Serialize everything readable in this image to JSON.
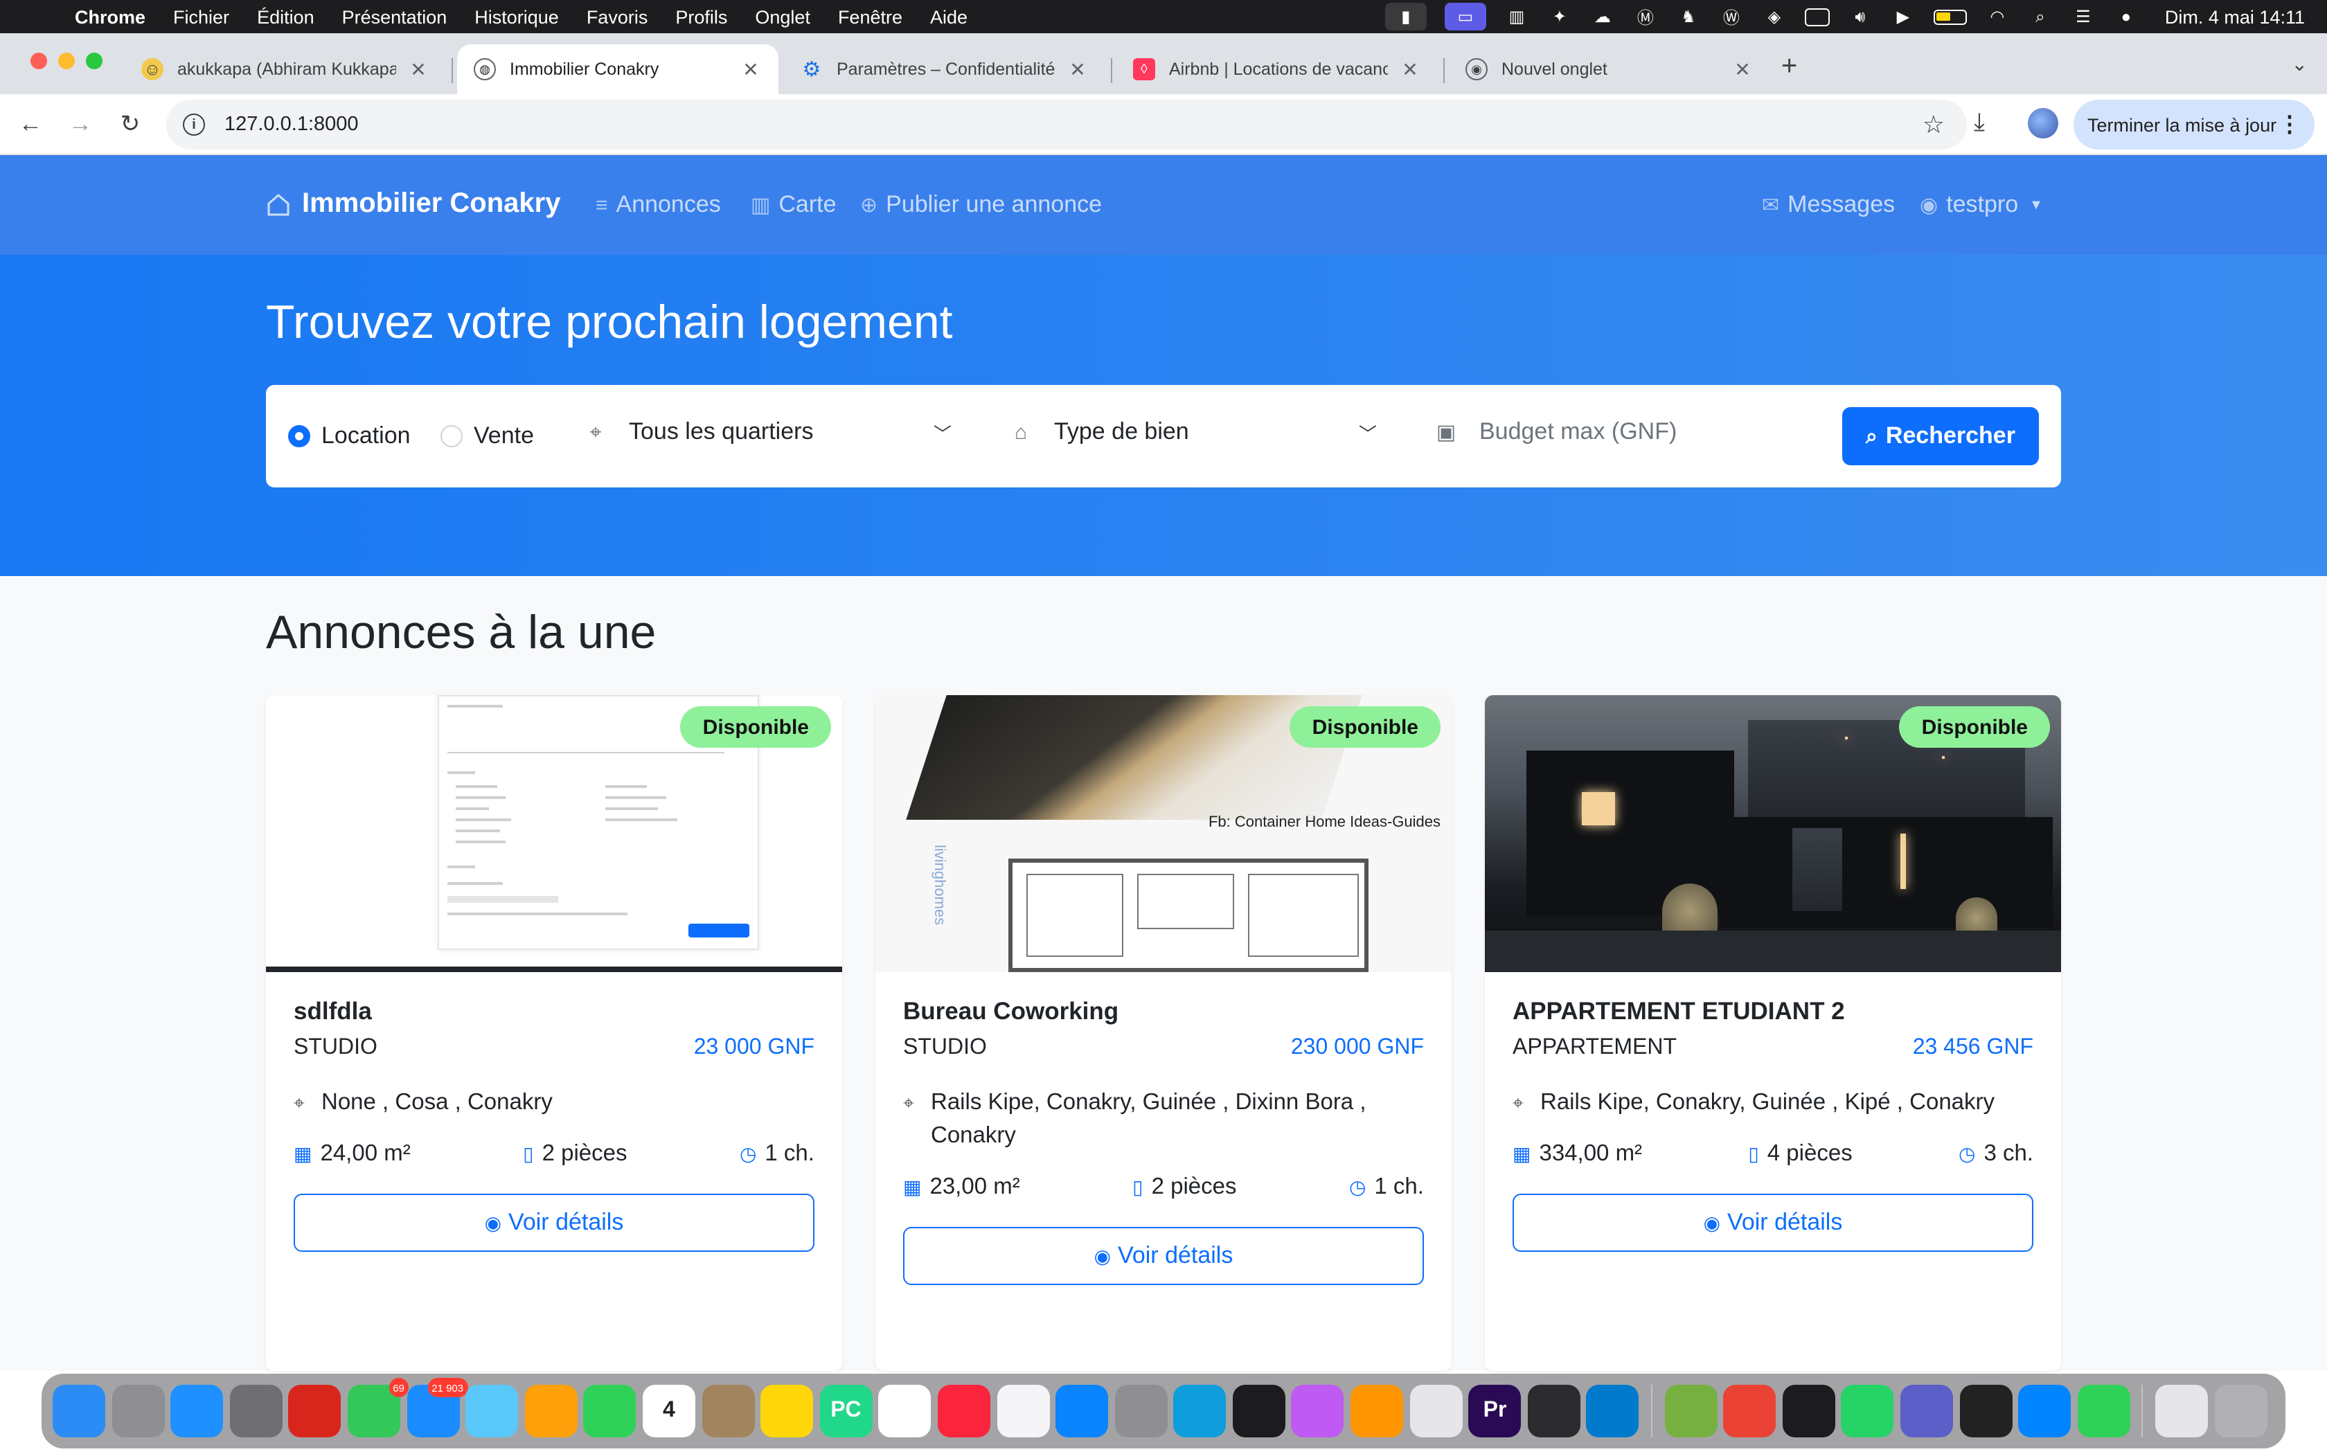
{
  "menubar": {
    "app": "Chrome",
    "items": [
      "Fichier",
      "Édition",
      "Présentation",
      "Historique",
      "Favoris",
      "Profils",
      "Onglet",
      "Fenêtre",
      "Aide"
    ],
    "clock": "Dim. 4 mai  14:11"
  },
  "tabs": [
    {
      "title": "akukkapa (Abhiram Kukkapalli)",
      "active": false
    },
    {
      "title": "Immobilier Conakry",
      "active": true
    },
    {
      "title": "Paramètres – Confidentialité et sécurité",
      "active": false
    },
    {
      "title": "Airbnb | Locations de vacances",
      "active": false
    },
    {
      "title": "Nouvel onglet",
      "active": false
    }
  ],
  "toolbar": {
    "url": "127.0.0.1:8000",
    "update_label": "Terminer la mise à jour"
  },
  "nav": {
    "brand": "Immobilier Conakry",
    "links": [
      "Annonces",
      "Carte",
      "Publier une annonce"
    ],
    "messages": "Messages",
    "user": "testpro"
  },
  "hero": {
    "title": "Trouvez votre prochain logement",
    "radio_location": "Location",
    "radio_vente": "Vente",
    "selected_mode": "Location",
    "quartier": "Tous les quartiers",
    "type_bien": "Type de bien",
    "budget_placeholder": "Budget max (GNF)",
    "search_button": "Rechercher"
  },
  "section_title": "Annonces à la une",
  "listings": [
    {
      "badge": "Disponible",
      "title": "sdlfdla",
      "type": "STUDIO",
      "price": "23 000 GNF",
      "location": "None , Cosa , Conakry",
      "area": "24,00 m²",
      "rooms": "2 pièces",
      "bedrooms": "1 ch.",
      "button": "Voir détails"
    },
    {
      "badge": "Disponible",
      "title": "Bureau Coworking",
      "type": "STUDIO",
      "price": "230 000 GNF",
      "location": "Rails Kipe, Conakry, Guinée , Dixinn Bora , Conakry",
      "area": "23,00 m²",
      "rooms": "2 pièces",
      "bedrooms": "1 ch.",
      "button": "Voir détails",
      "image_caption": "Fb: Container Home Ideas-Guides",
      "image_side_text": "livinghomes"
    },
    {
      "badge": "Disponible",
      "title": "APPARTEMENT ETUDIANT 2",
      "type": "APPARTEMENT",
      "price": "23 456 GNF",
      "location": "Rails Kipe, Conakry, Guinée , Kipé , Conakry",
      "area": "334,00 m²",
      "rooms": "4 pièces",
      "bedrooms": "3 ch.",
      "button": "Voir détails"
    }
  ],
  "dock": {
    "apps": [
      {
        "name": "Finder",
        "color": "#2b8cf5"
      },
      {
        "name": "Launchpad",
        "color": "#8e8e93"
      },
      {
        "name": "Safari",
        "color": "#1e90ff"
      },
      {
        "name": "Screenshot",
        "color": "#6e6e73"
      },
      {
        "name": "Acrobat",
        "color": "#d9261c"
      },
      {
        "name": "Messages",
        "color": "#34c759",
        "badge": "69"
      },
      {
        "name": "Mail",
        "color": "#1a8cff",
        "badge": "21 903"
      },
      {
        "name": "Maps",
        "color": "#5ac8fa"
      },
      {
        "name": "Photos",
        "color": "#ff9f0a"
      },
      {
        "name": "FaceTime",
        "color": "#30d158"
      },
      {
        "name": "Calendar",
        "color": "#ffffff",
        "label": "4"
      },
      {
        "name": "Contacts",
        "color": "#a2845e"
      },
      {
        "name": "Notes",
        "color": "#ffd60a"
      },
      {
        "name": "PyCharm",
        "color": "#21d789",
        "label": "PC"
      },
      {
        "name": "Freeform",
        "color": "#ffffff"
      },
      {
        "name": "Music",
        "color": "#fa243c"
      },
      {
        "name": "News",
        "color": "#f5f5f7"
      },
      {
        "name": "App Store",
        "color": "#0a84ff"
      },
      {
        "name": "System Settings",
        "color": "#8e8e93"
      },
      {
        "name": "Edge",
        "color": "#0f9ddb"
      },
      {
        "name": "ChatGPT",
        "color": "#1c1c1e"
      },
      {
        "name": "Feedback",
        "color": "#bf5af2"
      },
      {
        "name": "Pages",
        "color": "#ff9500"
      },
      {
        "name": "Preview",
        "color": "#e5e5ea"
      },
      {
        "name": "Premiere Pro",
        "color": "#2a0a55",
        "label": "Pr"
      },
      {
        "name": "Activity",
        "color": "#2c2c2e"
      },
      {
        "name": "VS Code",
        "color": "#007acc"
      },
      {
        "name": "uTorrent",
        "color": "#76b041"
      },
      {
        "name": "Chrome",
        "color": "#ea4335"
      },
      {
        "name": "Terminal",
        "color": "#1c1c1e"
      },
      {
        "name": "WhatsApp",
        "color": "#25d366"
      },
      {
        "name": "Teams",
        "color": "#5b5fc7"
      },
      {
        "name": "Unity",
        "color": "#222222"
      },
      {
        "name": "Messenger",
        "color": "#0084ff"
      },
      {
        "name": "FaceTime 2",
        "color": "#30d158"
      },
      {
        "name": "Documents",
        "color": "#e5e5ea"
      },
      {
        "name": "Trash",
        "color": "#b0b0b5"
      }
    ]
  }
}
